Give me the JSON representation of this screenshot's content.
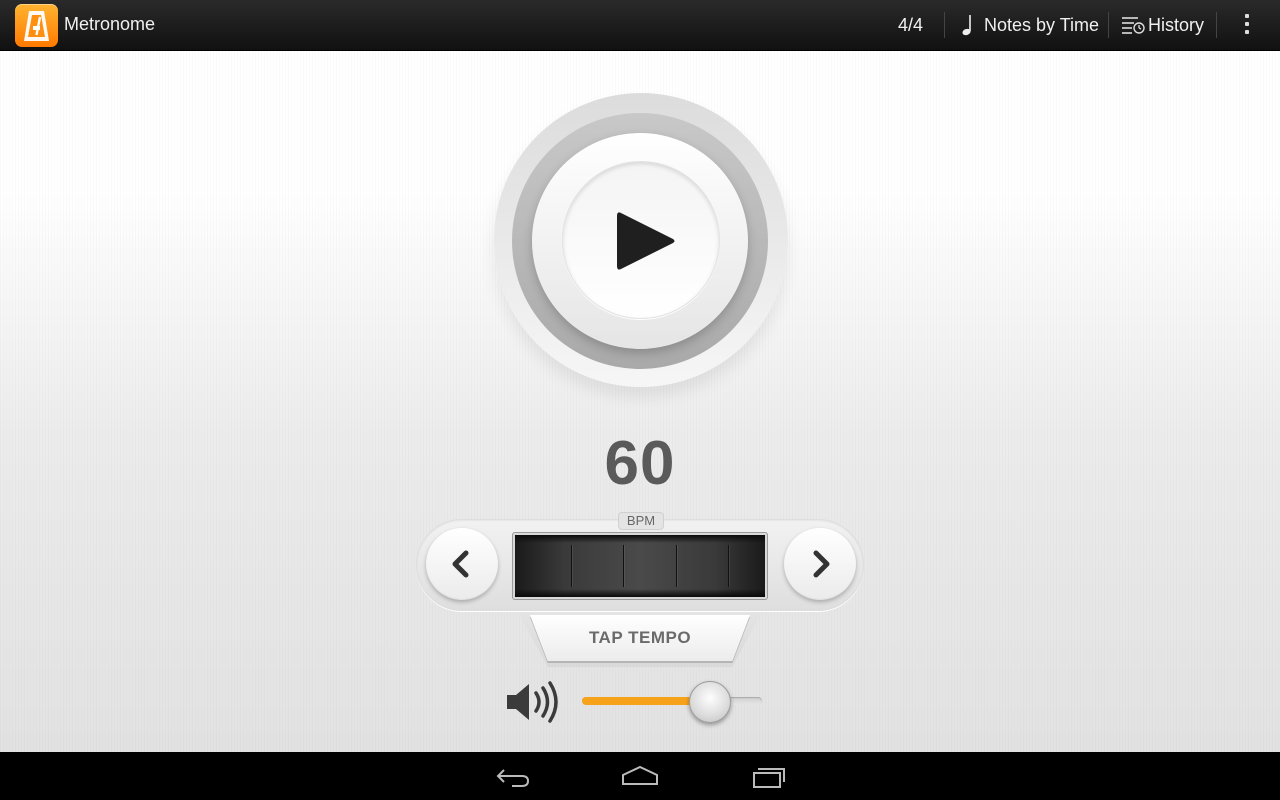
{
  "app": {
    "title": "Metronome",
    "accent_color": "#ff9a1a"
  },
  "actionbar": {
    "time_signature": "4/4",
    "notes_label": "Notes by Time",
    "history_label": "History",
    "icons": [
      "metronome-app-icon",
      "quarter-note-icon",
      "history-icon",
      "overflow-menu-icon"
    ]
  },
  "player": {
    "play_icon": "play-icon",
    "bpm_value": "60",
    "bpm_label": "BPM",
    "tap_tempo_label": "TAP TEMPO"
  },
  "volume": {
    "level_percent": 71,
    "fill_color": "#f7a21b"
  },
  "navbar": {
    "buttons": [
      "back-icon",
      "home-icon",
      "recent-apps-icon"
    ]
  }
}
